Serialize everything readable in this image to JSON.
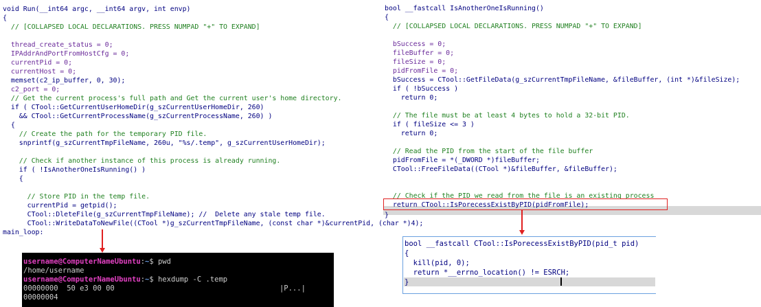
{
  "left_panel": {
    "lines": [
      "void Run(__int64 argc, __int64 argv, int envp)",
      "{",
      "  // [COLLAPSED LOCAL DECLARATIONS. PRESS NUMPAD \"+\" TO EXPAND]",
      "",
      "  thread_create_status = 0;",
      "  IPAddrAndPortFromHostCfg = 0;",
      "  currentPid = 0;",
      "  currentHost = 0;",
      "  memset(c2_ip_buffer, 0, 30);",
      "  c2_port = 0;",
      "  // Get the current process's full path and Get the current user's home directory.",
      "  if ( CTool::GetCurrentUserHomeDir(g_szCurrentUserHomeDir, 260)",
      "    && CTool::GetCurrentProcessName(g_szCurrentProcessName, 260) )",
      "  {",
      "    // Create the path for the temporary PID file.",
      "    snprintf(g_szCurrentTmpFileName, 260u, \"%s/.temp\", g_szCurrentUserHomeDir);",
      "",
      "    // Check if another instance of this process is already running.",
      "    if ( !IsAnotherOneIsRunning() )",
      "    {",
      "",
      "      // Store PID in the temp file.",
      "      currentPid = getpid();",
      "      CTool::DleteFile(g_szCurrentTmpFileName); //  Delete any stale temp file.",
      "      CTool::WriteDataToNewFile((CTool *)g_szCurrentTmpFileName, (const char *)&currentPid, (char *)4);",
      "main_loop:"
    ]
  },
  "terminal": {
    "lines": [
      {
        "user": "username@ComputerNameUbuntu",
        "path": "~",
        "cmd": "$ pwd"
      },
      {
        "out": "/home/username"
      },
      {
        "user": "username@ComputerNameUbuntu",
        "path": "~",
        "cmd": "$ hexdump -C .temp"
      },
      {
        "out": "00000000  50 e3 00 00                                      |P...|"
      },
      {
        "out": "00000004"
      }
    ]
  },
  "right_panel": {
    "lines": [
      "bool __fastcall IsAnotherOneIsRunning()",
      "{",
      "  // [COLLAPSED LOCAL DECLARATIONS. PRESS NUMPAD \"+\" TO EXPAND]",
      "",
      "  bSuccess = 0;",
      "  fileBuffer = 0;",
      "  fileSize = 0;",
      "  pidFromFile = 0;",
      "  bSuccess = CTool::GetFileData(g_szCurrentTmpFileName, &fileBuffer, (int *)&fileSize);",
      "  if ( !bSuccess )",
      "    return 0;",
      "",
      "  // The file must be at least 4 bytes to hold a 32-bit PID.",
      "  if ( fileSize <= 3 )",
      "    return 0;",
      "",
      "  // Read the PID from the start of the file buffer",
      "  pidFromFile = *(_DWORD *)fileBuffer;",
      "  CTool::FreeFileData((CTool *)&fileBuffer, &fileBuffer);",
      "",
      "  // Check if the PID we read from the file is an existing process",
      "  return CTool::IsPorecessExistByPID(pidFromFile);",
      "}"
    ]
  },
  "popup": {
    "lines": [
      "bool __fastcall CTool::IsPorecessExistByPID(pid_t pid)",
      "{",
      "  kill(pid, 0);",
      "  return *__errno_location() != ESRCH;",
      "}"
    ]
  },
  "colors": {
    "code": "#000080",
    "comment": "#208020",
    "local_var": "#6a2a9a",
    "highlight": "#e02020",
    "popup_border": "#6aa0e0"
  }
}
